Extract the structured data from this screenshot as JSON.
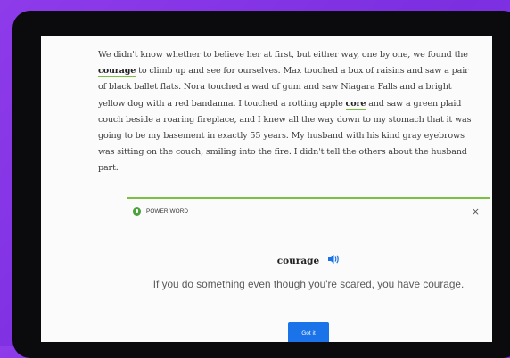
{
  "passage": {
    "text_1": "We didn't know whether to believe her at first, but either way, one by one, we found the ",
    "highlight_1": "courage",
    "text_2": " to climb up and see for ourselves. Max touched a box of raisins and saw a pair of black ballet flats. Nora touched a wad of gum and saw Niagara Falls and a bright yellow dog with a red bandanna. I touched a rotting apple ",
    "highlight_2": "core",
    "text_3": " and saw a green plaid couch beside a roaring fireplace, and I knew all the way down to my stomach that it was going to be my basement in exactly 55 years. My husband with his kind gray eyebrows was sitting on the couch, smiling into the fire. I didn't tell the others about the husband part."
  },
  "card": {
    "label": "POWER WORD",
    "close_icon": "×",
    "word": "courage",
    "definition": "If you do something even though you're scared, you have courage.",
    "button_label": "Got it"
  },
  "colors": {
    "accent_green": "#7ac143",
    "button_blue": "#1a73e8",
    "background_purple": "#8e3bea"
  },
  "icons": [
    "power-word-icon",
    "close-icon",
    "speaker-icon"
  ]
}
